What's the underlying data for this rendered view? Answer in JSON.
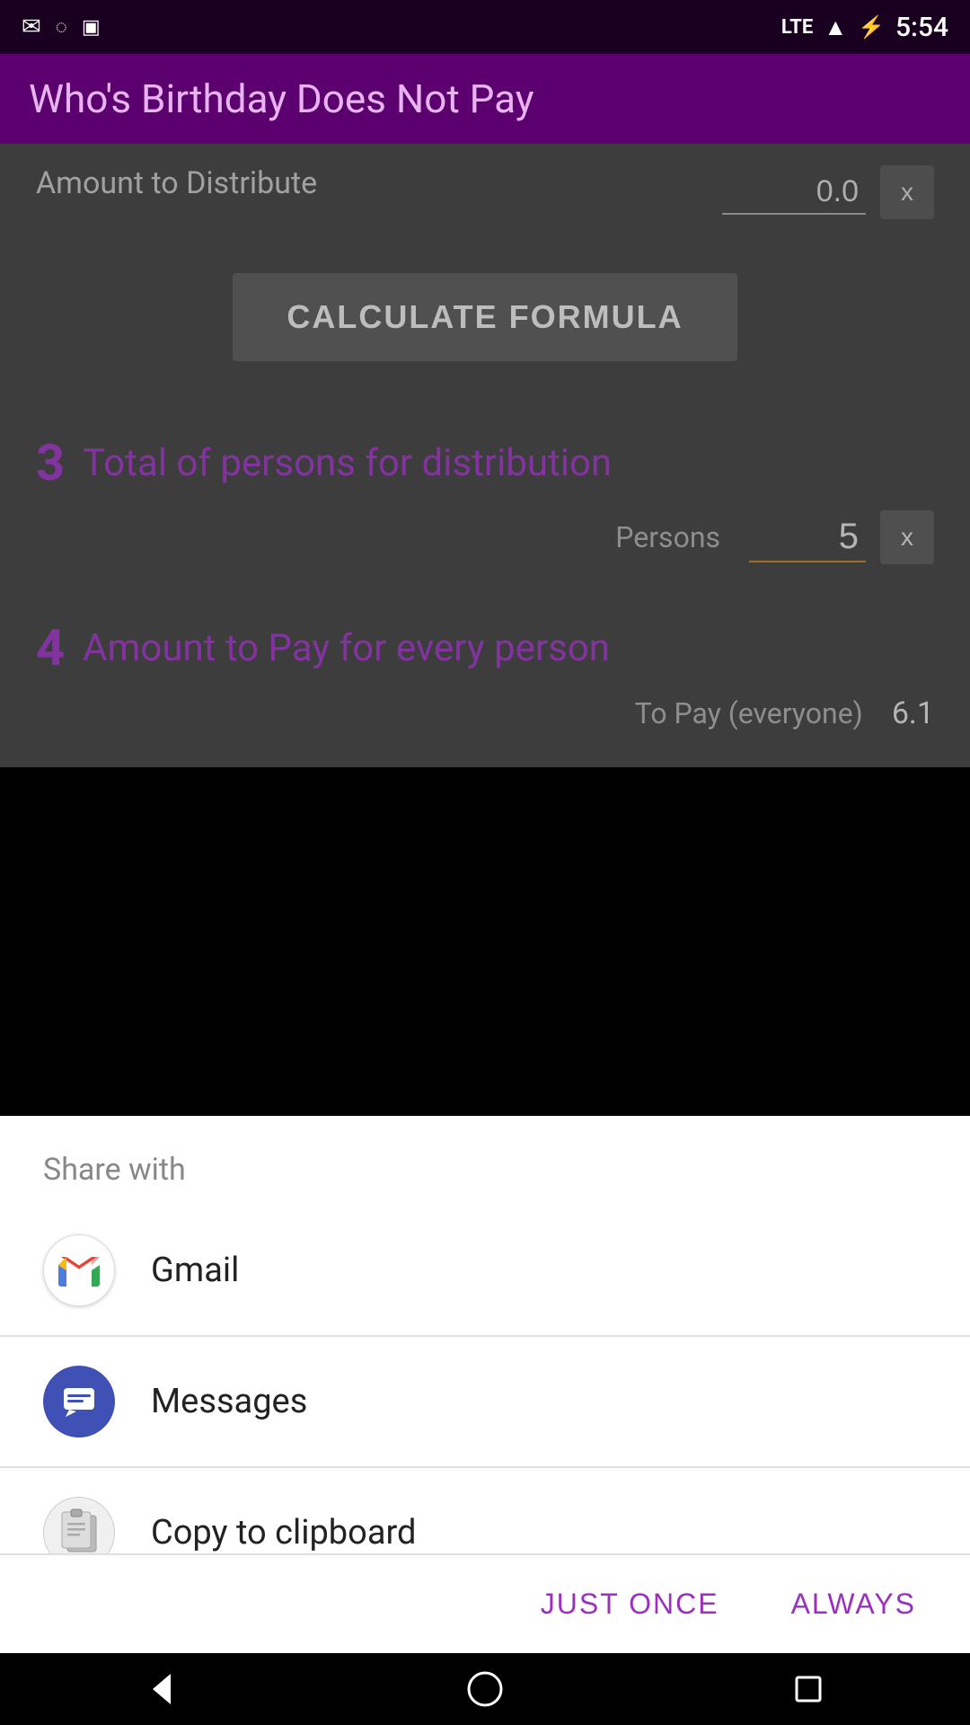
{
  "status_bar": {
    "time": "5:54",
    "lte": "LTE",
    "icons_left": [
      "gmail",
      "sync",
      "sd"
    ]
  },
  "app_header": {
    "title": "Who's Birthday Does Not Pay"
  },
  "section2": {
    "label": "Amount to Distribute",
    "value": "0.0",
    "x_label": "x"
  },
  "calculate_btn": {
    "label": "CALCULATE FORMULA"
  },
  "section3": {
    "number": "3",
    "title": "Total of persons for distribution",
    "persons_label": "Persons",
    "persons_value": "5",
    "x_label": "x"
  },
  "section4": {
    "number": "4",
    "title": "Amount to Pay for every person",
    "to_pay_label": "To Pay (everyone)",
    "to_pay_value": "6.1"
  },
  "share_sheet": {
    "header": "Share with",
    "items": [
      {
        "id": "gmail",
        "label": "Gmail"
      },
      {
        "id": "messages",
        "label": "Messages"
      },
      {
        "id": "clipboard",
        "label": "Copy to clipboard"
      }
    ]
  },
  "bottom_buttons": {
    "just_once": "JUST ONCE",
    "always": "ALWAYS"
  }
}
